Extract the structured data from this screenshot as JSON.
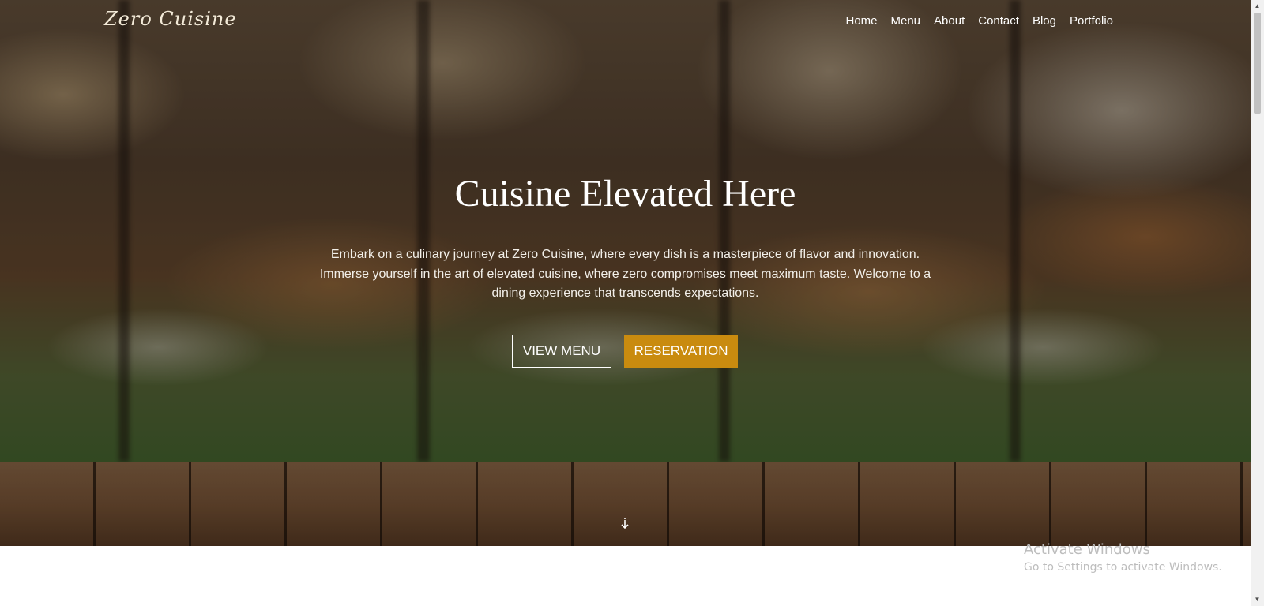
{
  "brand": {
    "logo_text": "Zero Cuisine"
  },
  "nav": {
    "items": [
      {
        "label": "Home"
      },
      {
        "label": "Menu"
      },
      {
        "label": "About"
      },
      {
        "label": "Contact"
      },
      {
        "label": "Blog"
      },
      {
        "label": "Portfolio"
      }
    ]
  },
  "hero": {
    "title": "Cuisine Elevated Here",
    "description": "Embark on a culinary journey at Zero Cuisine, where every dish is a masterpiece of flavor and innovation. Immerse yourself in the art of elevated cuisine, where zero compromises meet maximum taste. Welcome to a dining experience that transcends expectations.",
    "buttons": {
      "view_menu": "VIEW MENU",
      "reservation": "RESERVATION"
    },
    "scroll_icon": "arrow-down-icon"
  },
  "colors": {
    "accent": "#c98b0f",
    "text_light": "#ffffff"
  },
  "watermark": {
    "title": "Activate Windows",
    "subtitle": "Go to Settings to activate Windows."
  }
}
